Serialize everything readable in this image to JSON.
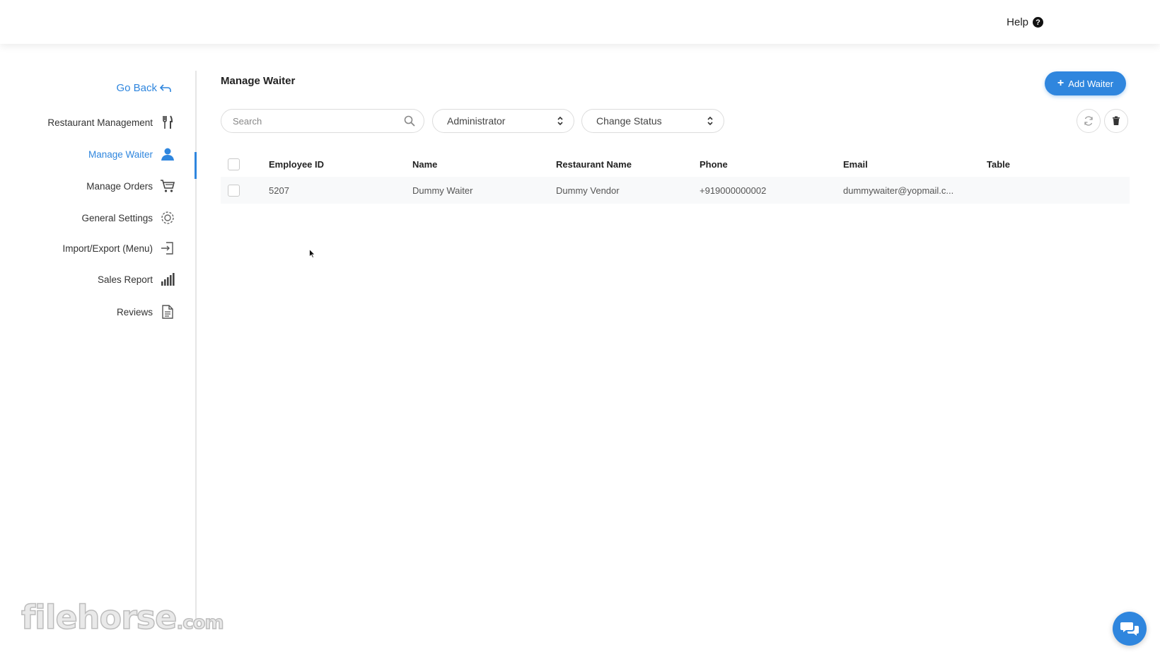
{
  "header": {
    "help_label": "Help"
  },
  "sidebar": {
    "go_back_label": "Go Back",
    "items": [
      {
        "label": "Restaurant Management",
        "icon": "utensils-icon"
      },
      {
        "label": "Manage Waiter",
        "icon": "user-icon",
        "active": true
      },
      {
        "label": "Manage Orders",
        "icon": "cart-icon"
      },
      {
        "label": "General Settings",
        "icon": "gear-icon"
      },
      {
        "label": "Import/Export (Menu)",
        "icon": "import-icon"
      },
      {
        "label": "Sales Report",
        "icon": "bar-signal-icon"
      },
      {
        "label": "Reviews",
        "icon": "document-icon"
      }
    ]
  },
  "main": {
    "title": "Manage Waiter",
    "add_button_label": "Add Waiter",
    "search": {
      "placeholder": "Search",
      "value": ""
    },
    "role_select": {
      "value": "Administrator"
    },
    "status_select": {
      "value": "Change Status"
    }
  },
  "table": {
    "columns": [
      "Employee ID",
      "Name",
      "Restaurant Name",
      "Phone",
      "Email",
      "Table"
    ],
    "rows": [
      [
        "5207",
        "Dummy Waiter",
        "Dummy Vendor",
        "+919000000002",
        "dummywaiter@yopmail.c...",
        ""
      ]
    ]
  },
  "watermark": {
    "text": "filehorse",
    "suffix": ".com"
  },
  "colors": {
    "accent": "#2f86de"
  }
}
